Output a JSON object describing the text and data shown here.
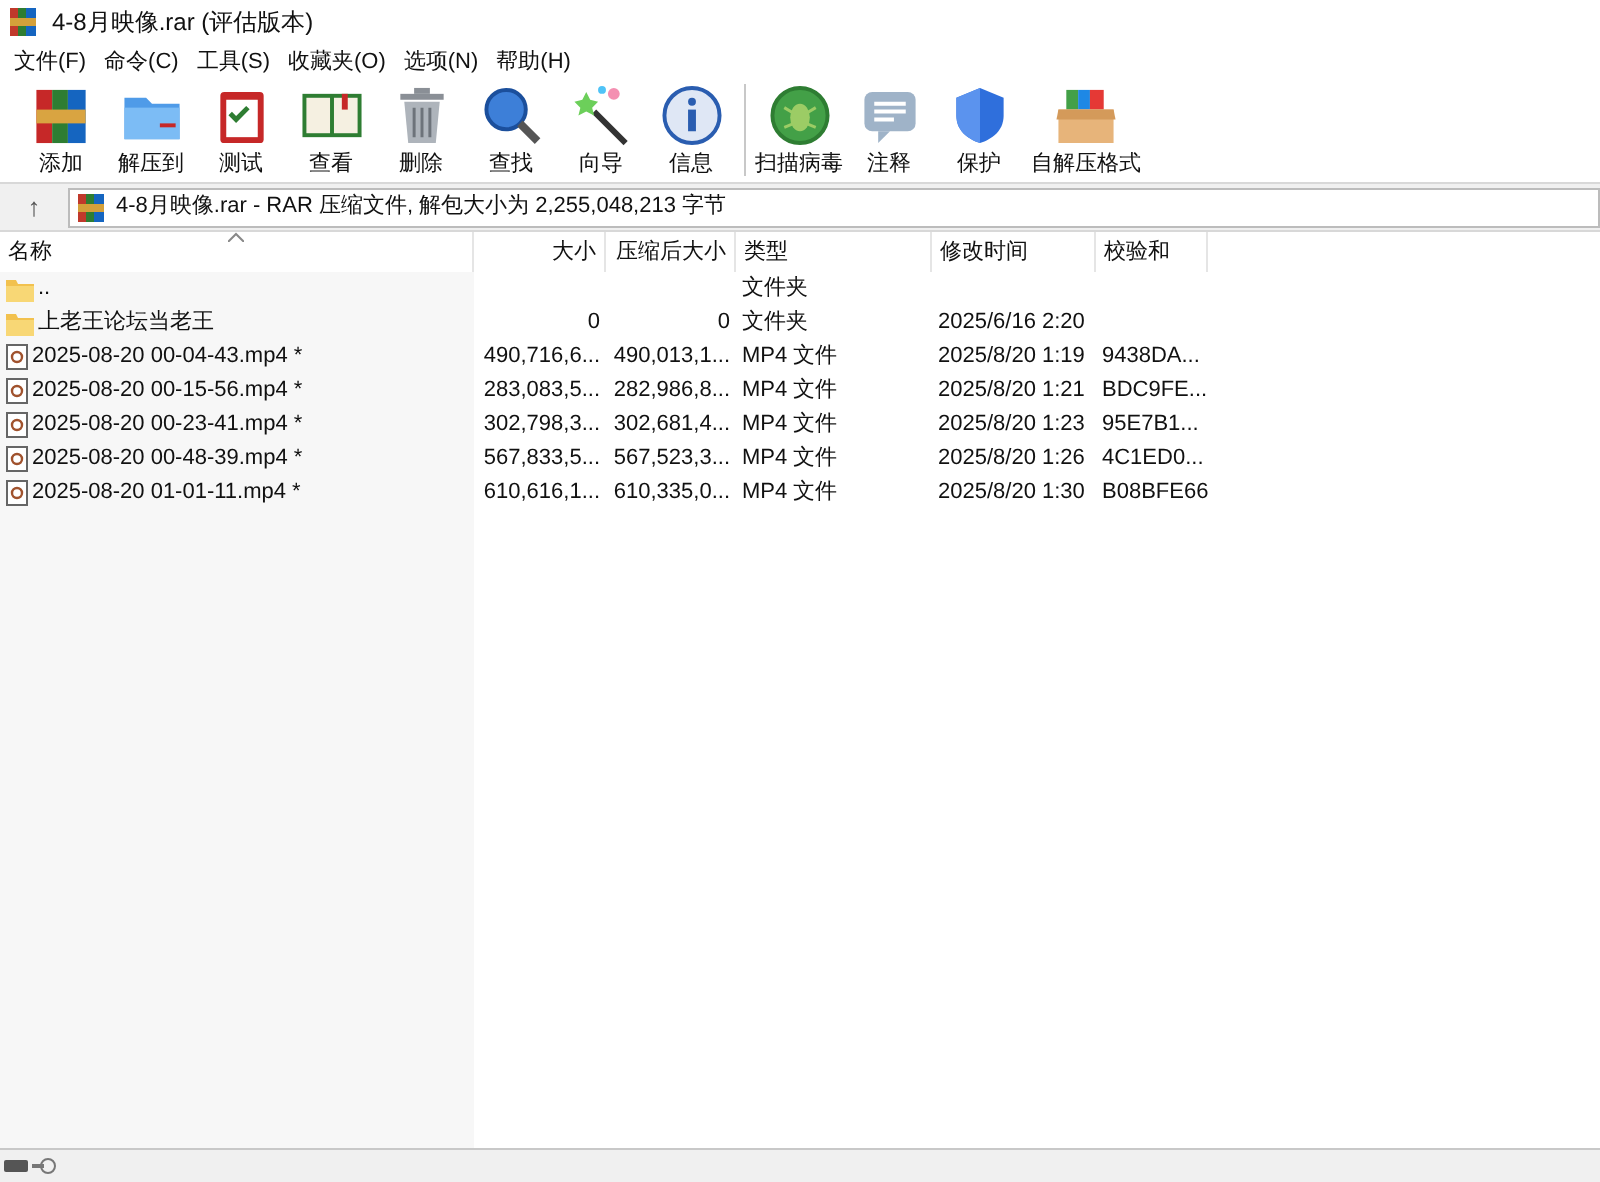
{
  "window": {
    "title": "4-8月映像.rar (评估版本)"
  },
  "menu": [
    "文件(F)",
    "命令(C)",
    "工具(S)",
    "收藏夹(O)",
    "选项(N)",
    "帮助(H)"
  ],
  "toolbar": [
    {
      "label": "添加"
    },
    {
      "label": "解压到"
    },
    {
      "label": "测试"
    },
    {
      "label": "查看"
    },
    {
      "label": "删除"
    },
    {
      "label": "查找"
    },
    {
      "label": "向导"
    },
    {
      "label": "信息"
    },
    {
      "label": "扫描病毒"
    },
    {
      "label": "注释"
    },
    {
      "label": "保护"
    },
    {
      "label": "自解压格式"
    }
  ],
  "address": {
    "up": "↑",
    "path": "4-8月映像.rar - RAR 压缩文件, 解包大小为 2,255,048,213 字节"
  },
  "table": {
    "columns": [
      "名称",
      "大小",
      "压缩后大小",
      "类型",
      "修改时间",
      "校验和"
    ],
    "rows": [
      {
        "kind": "folder",
        "cells": [
          "..",
          "",
          "",
          "文件夹",
          "",
          ""
        ]
      },
      {
        "kind": "folder",
        "cells": [
          "上老王论坛当老王",
          "0",
          "0",
          "文件夹",
          "2025/6/16 2:20",
          ""
        ]
      },
      {
        "kind": "file",
        "cells": [
          "2025-08-20 00-04-43.mp4 *",
          "490,716,6...",
          "490,013,1...",
          "MP4 文件",
          "2025/8/20 1:19",
          "9438DA..."
        ]
      },
      {
        "kind": "file",
        "cells": [
          "2025-08-20 00-15-56.mp4 *",
          "283,083,5...",
          "282,986,8...",
          "MP4 文件",
          "2025/8/20 1:21",
          "BDC9FE..."
        ]
      },
      {
        "kind": "file",
        "cells": [
          "2025-08-20 00-23-41.mp4 *",
          "302,798,3...",
          "302,681,4...",
          "MP4 文件",
          "2025/8/20 1:23",
          "95E7B1..."
        ]
      },
      {
        "kind": "file",
        "cells": [
          "2025-08-20 00-48-39.mp4 *",
          "567,833,5...",
          "567,523,3...",
          "MP4 文件",
          "2025/8/20 1:26",
          "4C1ED0..."
        ]
      },
      {
        "kind": "file",
        "cells": [
          "2025-08-20 01-01-11.mp4 *",
          "610,616,1...",
          "610,335,0...",
          "MP4 文件",
          "2025/8/20 1:30",
          "B08BFE66"
        ]
      }
    ]
  }
}
